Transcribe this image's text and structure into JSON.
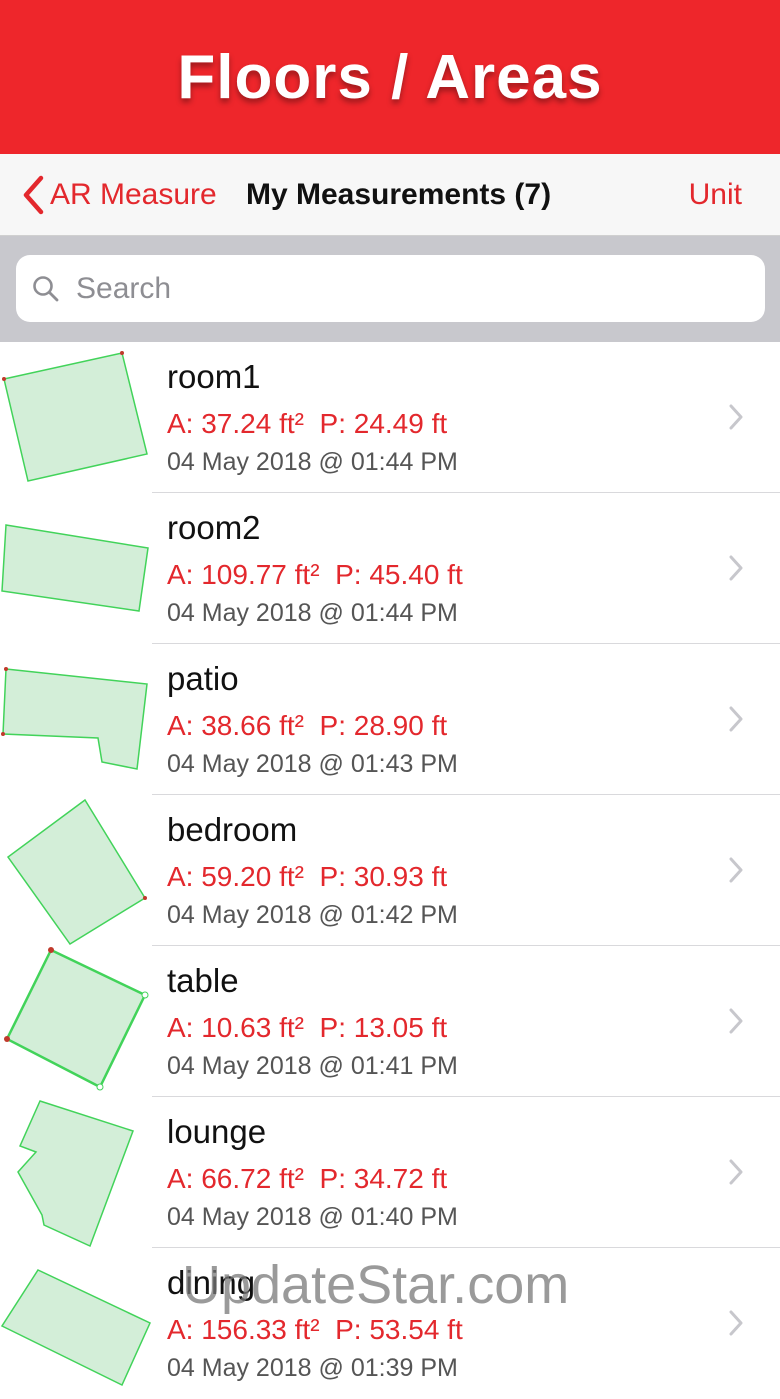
{
  "banner": {
    "title": "Floors / Areas"
  },
  "navbar": {
    "back_label": "AR Measure",
    "title": "My Measurements (7)",
    "unit_label": "Unit"
  },
  "search": {
    "placeholder": "Search",
    "value": ""
  },
  "colors": {
    "accent": "#e3282d",
    "banner": "#ee262b",
    "shape_fill": "#d3eed8",
    "shape_stroke": "#42d35a"
  },
  "measurements": [
    {
      "name": "room1",
      "metrics": "A: 37.24 ft²  P: 24.49 ft",
      "date": "04 May 2018 @ 01:44 PM"
    },
    {
      "name": "room2",
      "metrics": "A: 109.77 ft²  P: 45.40 ft",
      "date": "04 May 2018 @ 01:44 PM"
    },
    {
      "name": "patio",
      "metrics": "A: 38.66 ft²  P: 28.90 ft",
      "date": "04 May 2018 @ 01:43 PM"
    },
    {
      "name": "bedroom",
      "metrics": "A: 59.20 ft²  P: 30.93 ft",
      "date": "04 May 2018 @ 01:42 PM"
    },
    {
      "name": "table",
      "metrics": "A: 10.63 ft²  P: 13.05 ft",
      "date": "04 May 2018 @ 01:41 PM"
    },
    {
      "name": "lounge",
      "metrics": "A: 66.72 ft²  P: 34.72 ft",
      "date": "04 May 2018 @ 01:40 PM"
    },
    {
      "name": "dining",
      "metrics": "A: 156.33 ft²  P: 53.54 ft",
      "date": "04 May 2018 @ 01:39 PM"
    }
  ],
  "watermark": "UpdateStar.com"
}
